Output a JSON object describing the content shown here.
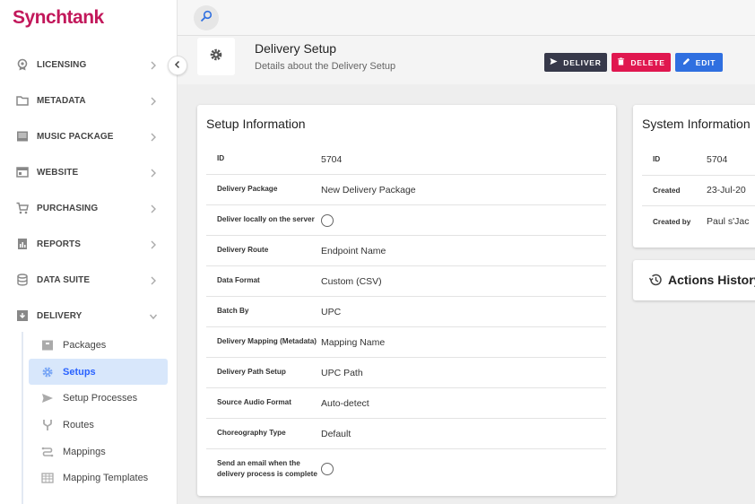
{
  "app": {
    "logo": "Synchtank"
  },
  "sidebar": {
    "items": [
      {
        "label": "LICENSING",
        "icon": "licensing-icon"
      },
      {
        "label": "METADATA",
        "icon": "folder-icon"
      },
      {
        "label": "MUSIC PACKAGE",
        "icon": "package-icon"
      },
      {
        "label": "WEBSITE",
        "icon": "website-icon"
      },
      {
        "label": "PURCHASING",
        "icon": "cart-icon"
      },
      {
        "label": "REPORTS",
        "icon": "reports-icon"
      },
      {
        "label": "DATA SUITE",
        "icon": "database-icon"
      },
      {
        "label": "DELIVERY",
        "icon": "delivery-icon"
      }
    ],
    "delivery_sub": [
      {
        "label": "Packages",
        "icon": "box-icon"
      },
      {
        "label": "Setups",
        "icon": "gear-icon"
      },
      {
        "label": "Setup Processes",
        "icon": "send-icon"
      },
      {
        "label": "Routes",
        "icon": "route-icon"
      },
      {
        "label": "Mappings",
        "icon": "mapping-icon"
      },
      {
        "label": "Mapping Templates",
        "icon": "template-icon"
      }
    ]
  },
  "header": {
    "title": "Delivery Setup",
    "subtitle": "Details about the Delivery Setup",
    "buttons": {
      "deliver": "DELIVER",
      "delete": "DELETE",
      "edit": "EDIT"
    }
  },
  "setup": {
    "title": "Setup Information",
    "rows": [
      {
        "label": "ID",
        "value": "5704"
      },
      {
        "label": "Delivery Package",
        "value": "New Delivery Package"
      },
      {
        "label": "Deliver locally on the server",
        "value": ""
      },
      {
        "label": "Delivery Route",
        "value": "Endpoint Name"
      },
      {
        "label": "Data Format",
        "value": "Custom (CSV)"
      },
      {
        "label": "Batch By",
        "value": "UPC"
      },
      {
        "label": "Delivery Mapping (Metadata)",
        "value": "Mapping Name"
      },
      {
        "label": "Delivery Path Setup",
        "value": "UPC Path"
      },
      {
        "label": "Source Audio Format",
        "value": "Auto-detect"
      },
      {
        "label": "Choreography Type",
        "value": "Default"
      },
      {
        "label": "Send an email when the delivery process is complete",
        "value": ""
      }
    ]
  },
  "system": {
    "title": "System Information",
    "rows": [
      {
        "label": "ID",
        "value": "5704"
      },
      {
        "label": "Created",
        "value": "23-Jul-20"
      },
      {
        "label": "Created by",
        "value": "Paul s'Jac"
      }
    ]
  },
  "history": {
    "title": "Actions History"
  },
  "colors": {
    "brand": "#c2185b",
    "accent": "#2962ff",
    "deliver": "#37394a",
    "delete": "#e0174f",
    "edit": "#2f6fe0"
  }
}
